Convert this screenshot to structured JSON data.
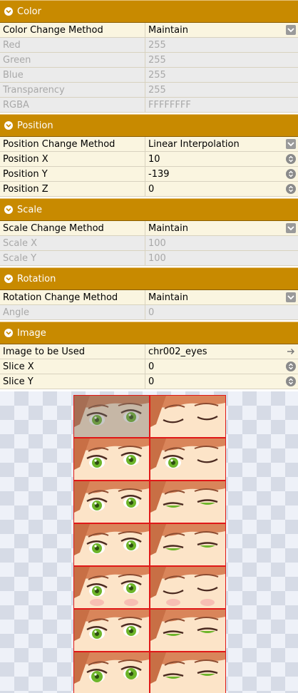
{
  "sections": {
    "color": {
      "title": "Color",
      "rows": [
        {
          "label": "Color Change Method",
          "value": "Maintain"
        },
        {
          "label": "Red",
          "value": "255"
        },
        {
          "label": "Green",
          "value": "255"
        },
        {
          "label": "Blue",
          "value": "255"
        },
        {
          "label": "Transparency",
          "value": "255"
        },
        {
          "label": "RGBA",
          "value": "FFFFFFFF"
        }
      ]
    },
    "position": {
      "title": "Position",
      "rows": [
        {
          "label": "Position Change Method",
          "value": "Linear Interpolation"
        },
        {
          "label": "Position X",
          "value": "10"
        },
        {
          "label": "Position Y",
          "value": "-139"
        },
        {
          "label": "Position Z",
          "value": "0"
        }
      ]
    },
    "scale": {
      "title": "Scale",
      "rows": [
        {
          "label": "Scale Change Method",
          "value": "Maintain"
        },
        {
          "label": "Scale X",
          "value": "100"
        },
        {
          "label": "Scale Y",
          "value": "100"
        }
      ]
    },
    "rotation": {
      "title": "Rotation",
      "rows": [
        {
          "label": "Rotation Change Method",
          "value": "Maintain"
        },
        {
          "label": "Angle",
          "value": "0"
        }
      ]
    },
    "image": {
      "title": "Image",
      "rows": [
        {
          "label": "Image to be Used",
          "value": "chr002_eyes"
        },
        {
          "label": "Slice X",
          "value": "0"
        },
        {
          "label": "Slice Y",
          "value": "0"
        }
      ]
    }
  },
  "preview": {
    "sheet_rows": 7,
    "sheet_cols": 2,
    "selected_cell": "0,0",
    "cells": [
      [
        "open",
        "closed"
      ],
      [
        "open",
        "wink"
      ],
      [
        "open",
        "half-closed"
      ],
      [
        "open",
        "half-closed"
      ],
      [
        "open-blush",
        "closed-blush"
      ],
      [
        "open",
        "half-closed"
      ],
      [
        "open-wide",
        "half-closed"
      ]
    ]
  },
  "colors": {
    "header_bg": "#c88a00",
    "disabled_bg": "#ebebeb",
    "active_row_bg": "#faf5e0",
    "cell_border": "#e01818",
    "eye_green": "#6db52a"
  },
  "icons": {
    "section": "chevron-down-circle-icon",
    "dropdown": "dropdown-arrow-icon",
    "spinner": "spinner-updown-icon",
    "image_picker": "arrow-right-icon"
  }
}
